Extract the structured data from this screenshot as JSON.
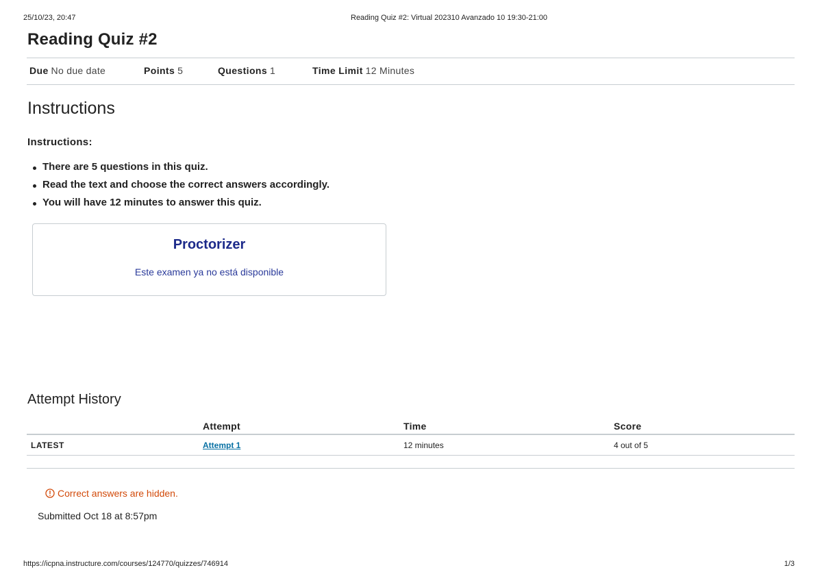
{
  "print_header": {
    "datetime": "25/10/23, 20:47",
    "document_title": "Reading Quiz #2: Virtual 202310 Avanzado 10 19:30-21:00"
  },
  "quiz": {
    "title": "Reading Quiz #2",
    "meta": {
      "due_label": "Due",
      "due_value": "No due date",
      "points_label": "Points",
      "points_value": "5",
      "questions_label": "Questions",
      "questions_value": "1",
      "time_limit_label": "Time Limit",
      "time_limit_value": "12 Minutes"
    }
  },
  "instructions": {
    "heading": "Instructions",
    "label": "Instructions:",
    "bullets": [
      "There are 5 questions in this quiz.",
      "Read the text and choose the correct answers accordingly.",
      "You will have 12 minutes to answer this quiz."
    ]
  },
  "proctorizer": {
    "title": "Proctorizer",
    "message": "Este examen ya no está disponible"
  },
  "attempt_history": {
    "heading": "Attempt History",
    "columns": [
      "Attempt",
      "Time",
      "Score"
    ],
    "rows": [
      {
        "label": "LATEST",
        "attempt": "Attempt 1",
        "time": "12 minutes",
        "score": "4 out of 5"
      }
    ]
  },
  "notice": {
    "icon": "alert-circle-icon",
    "text": "Correct answers are hidden.",
    "color": "#d24a0a"
  },
  "submitted_text": "Submitted Oct 18 at 8:57pm",
  "print_footer": {
    "url": "https://icpna.instructure.com/courses/124770/quizzes/746914",
    "page": "1/3"
  }
}
